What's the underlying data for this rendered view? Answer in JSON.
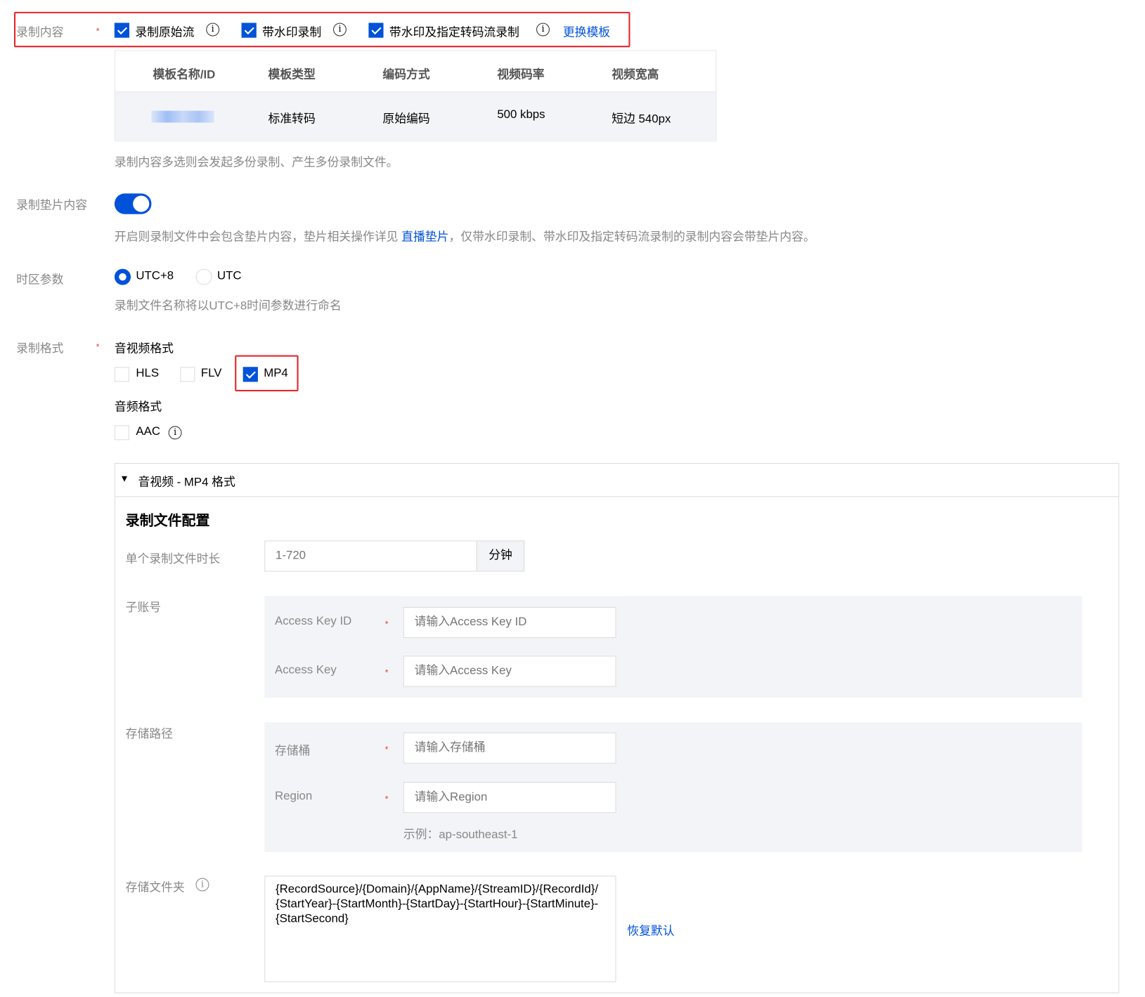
{
  "record_content": {
    "label": "录制内容",
    "options": [
      {
        "label": "录制原始流",
        "checked": true
      },
      {
        "label": "带水印录制",
        "checked": true
      },
      {
        "label": "带水印及指定转码流录制",
        "checked": true
      }
    ],
    "change_template": "更换模板",
    "table": {
      "headers": [
        "模板名称/ID",
        "模板类型",
        "编码方式",
        "视频码率",
        "视频宽高"
      ],
      "row": [
        "",
        "标准转码",
        "原始编码",
        "500 kbps",
        "短边 540px"
      ]
    },
    "help": "录制内容多选则会发起多份录制、产生多份录制文件。"
  },
  "slate": {
    "label": "录制垫片内容",
    "enabled": true,
    "help_pre": "开启则录制文件中会包含垫片内容，垫片相关操作详见 ",
    "help_link": "直播垫片",
    "help_post": "，仅带水印录制、带水印及指定转码流录制的录制内容会带垫片内容。"
  },
  "timezone": {
    "label": "时区参数",
    "options": [
      {
        "label": "UTC+8",
        "selected": true
      },
      {
        "label": "UTC",
        "selected": false
      }
    ],
    "help": "录制文件名称将以UTC+8时间参数进行命名"
  },
  "format": {
    "label": "录制格式",
    "av_title": "音视频格式",
    "av_options": [
      {
        "label": "HLS",
        "checked": false
      },
      {
        "label": "FLV",
        "checked": false
      },
      {
        "label": "MP4",
        "checked": true
      }
    ],
    "audio_title": "音频格式",
    "audio_options": [
      {
        "label": "AAC",
        "checked": false
      }
    ]
  },
  "panel": {
    "title": "音视频 - MP4 格式",
    "section": "录制文件配置",
    "duration": {
      "label": "单个录制文件时长",
      "placeholder": "1-720",
      "unit": "分钟"
    },
    "subaccount": {
      "label": "子账号",
      "key_id_label": "Access Key ID",
      "key_id_placeholder": "请输入Access Key ID",
      "key_label": "Access Key",
      "key_placeholder": "请输入Access Key"
    },
    "storage": {
      "label": "存储路径",
      "bucket_label": "存储桶",
      "bucket_placeholder": "请输入存储桶",
      "region_label": "Region",
      "region_placeholder": "请输入Region",
      "region_example": "示例：ap-southeast-1"
    },
    "folder": {
      "label": "存储文件夹",
      "value": "{RecordSource}/{Domain}/{AppName}/{StreamID}/{RecordId}/{StartYear}-{StartMonth}-{StartDay}-{StartHour}-{StartMinute}-{StartSecond}",
      "restore": "恢复默认"
    }
  },
  "required_mark": "*",
  "colors": {
    "primary": "#0052d9",
    "highlight": "#e5262b"
  }
}
